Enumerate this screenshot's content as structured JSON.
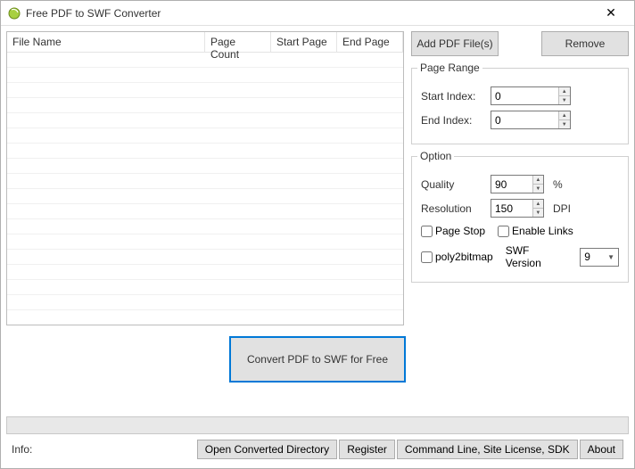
{
  "window": {
    "title": "Free PDF to SWF Converter"
  },
  "grid": {
    "columns": {
      "file_name": "File Name",
      "page_count": "Page Count",
      "start_page": "Start Page",
      "end_page": "End Page"
    }
  },
  "buttons": {
    "add": "Add PDF File(s)",
    "remove": "Remove",
    "convert": "Convert PDF to SWF for Free"
  },
  "page_range": {
    "legend": "Page Range",
    "start_label": "Start Index:",
    "start_value": "0",
    "end_label": "End Index:",
    "end_value": "0"
  },
  "option": {
    "legend": "Option",
    "quality_label": "Quality",
    "quality_value": "90",
    "quality_unit": "%",
    "resolution_label": "Resolution",
    "resolution_value": "150",
    "resolution_unit": "DPI",
    "page_stop": "Page Stop",
    "enable_links": "Enable Links",
    "poly2bitmap": "poly2bitmap",
    "swf_version_label": "SWF Version",
    "swf_version_value": "9"
  },
  "footer": {
    "info_label": "Info:",
    "open_dir": "Open Converted Directory",
    "register": "Register",
    "cmd_line": "Command Line, Site License, SDK",
    "about": "About"
  }
}
